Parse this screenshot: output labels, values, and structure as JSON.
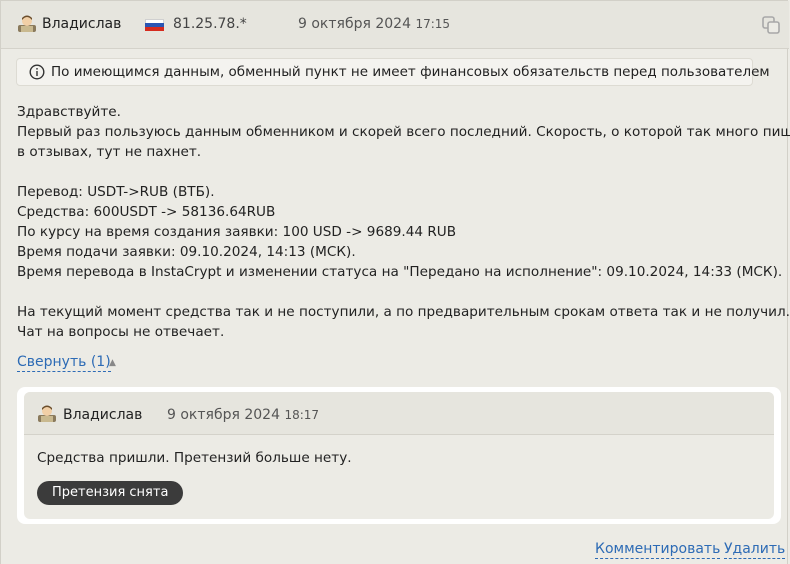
{
  "review": {
    "author": "Владислав",
    "ip": "81.25.78.*",
    "date": "9 октября 2024",
    "time": "17:15",
    "notice": "По имеющимся данным, обменный пункт не имеет финансовых обязательств перед пользователем",
    "paragraphs": {
      "greeting": "Здравствуйте.",
      "intro1": "Первый раз пользуюсь данным обменником и скорей всего последний. Скорость, о которой так много пишут",
      "intro2": "в отзывах, тут не пахнет.",
      "transfer": "Перевод: USDT->RUB (ВТБ).",
      "funds": "Средства: 600USDT -> 58136.64RUB",
      "rate": "По курсу на время создания заявки: 100 USD -> 9689.44 RUB",
      "submitted": "Время подачи заявки: 09.10.2024, 14:13 (МСК).",
      "status_time": "Время перевода в InstaCrypt и изменении статуса на \"Передано на исполнение\": 09.10.2024, 14:33 (МСК).",
      "current1": "На текущий момент средства так и не поступили, а по предварительным срокам ответа так и не получил.",
      "current2": "Чат на вопросы не отвечает."
    },
    "collapse_label": "Свернуть (1)"
  },
  "reply": {
    "author": "Владислав",
    "date": "9 октября 2024",
    "time": "18:17",
    "text": "Средства пришли. Претензий больше нету.",
    "badge": "Претензия снята"
  },
  "footer": {
    "comment_label": "Комментировать",
    "delete_label": "Удалить"
  },
  "colors": {
    "link": "#2d6bb5",
    "badge_bg": "#3b3b3b",
    "background": "#ecebe5"
  }
}
